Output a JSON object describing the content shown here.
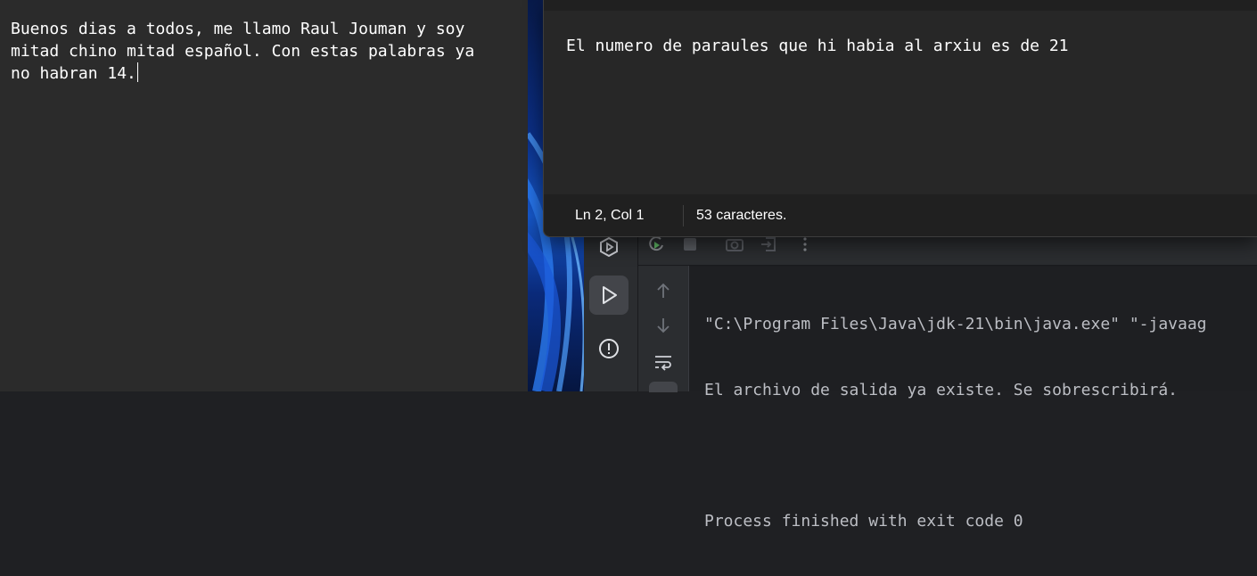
{
  "left_editor": {
    "lines": [
      "Buenos dias a todos, me llamo Raul Jouman y soy",
      "mitad chino mitad español. Con estas palabras ya",
      "no habran 14."
    ]
  },
  "notepad": {
    "content": "El numero de paraules que hi habia al arxiu es de 21",
    "status": {
      "position": "Ln 2, Col 1",
      "characters": "53 caracteres."
    }
  },
  "ide": {
    "console_lines": [
      "\"C:\\Program Files\\Java\\jdk-21\\bin\\java.exe\" \"-javaag",
      "El archivo de salida ya existe. Se sobrescribirá.",
      "",
      "Process finished with exit code 0"
    ],
    "icons": {
      "services": "services-icon",
      "run": "run-icon",
      "problems": "problems-icon",
      "rerun": "rerun-icon",
      "stop": "stop-icon",
      "screenshot": "camera-icon",
      "exit": "exit-icon",
      "more": "more-icon",
      "up": "arrow-up-icon",
      "down": "arrow-down-icon",
      "wrap": "soft-wrap-icon"
    }
  },
  "colors": {
    "editor_bg": "#2b2b2b",
    "ide_bg": "#1e1f22",
    "run_green": "#5fb865"
  }
}
